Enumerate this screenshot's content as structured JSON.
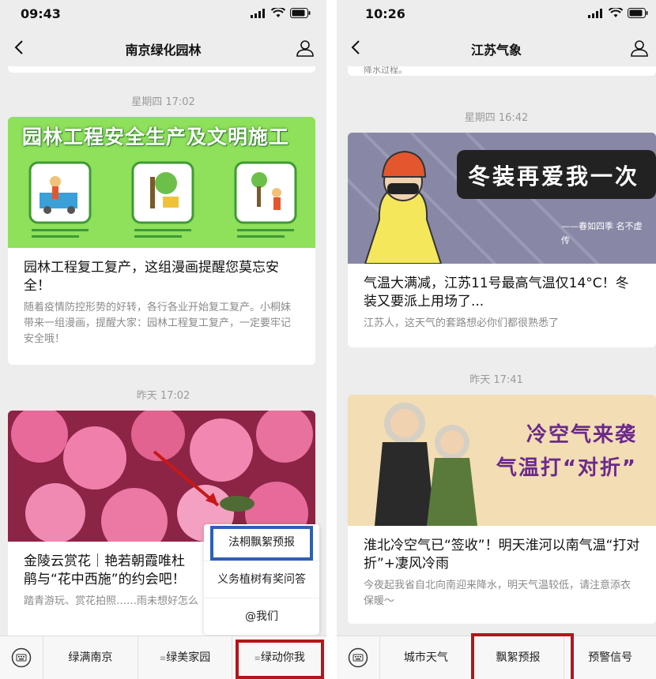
{
  "left": {
    "status_time": "09:43",
    "title": "南京绿化园林",
    "posts": [
      {
        "timestamp": "星期四 17:02",
        "banner_text": "园林工程安全生产及文明施工",
        "title": "园林工程复工复产，这组漫画提醒您莫忘安全！",
        "desc": "随着疫情防控形势的好转，各行各业开始复工复产。小桐妹带来一组漫画，提醒大家：园林工程复工复产，一定要牢记安全哦！"
      },
      {
        "timestamp": "昨天 17:02",
        "title": "金陵云赏花｜艳若朝霞唯杜鹃与“花中西施”的约会吧！",
        "desc": "踏青游玩、赏花拍照……雨未想好怎么"
      }
    ],
    "popup": [
      "法桐飘絮预报",
      "义务植树有奖问答",
      "@我们"
    ],
    "menu": [
      "绿满南京",
      "绿美家园",
      "绿动你我"
    ]
  },
  "right": {
    "status_time": "10:26",
    "title": "江苏气象",
    "top_snippet": "降水过程。",
    "posts": [
      {
        "timestamp": "星期四 16:42",
        "banner_text": "冬装再爱我一次",
        "banner_sub": "——春如四季 名不虚传",
        "title": "气温大满减，江苏11号最高气温仅14°C！冬装又要派上用场了...",
        "desc": "江苏人，这天气的套路想必你们都很熟悉了"
      },
      {
        "timestamp": "昨天 17:41",
        "banner_text_1": "冷空气来袭",
        "banner_text_2": "气温打“对折”",
        "title": "淮北冷空气已“签收”！明天淮河以南气温“打对折”+凄风冷雨",
        "desc": "今夜起我省自北向南迎来降水，明天气温较低，请注意添衣保暖～"
      }
    ],
    "menu": [
      "城市天气",
      "飘絮预报",
      "预警信号"
    ]
  }
}
